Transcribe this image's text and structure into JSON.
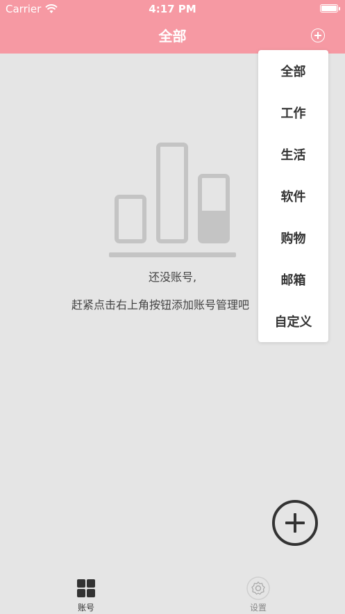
{
  "status_bar": {
    "carrier": "Carrier",
    "time": "4:17 PM",
    "wifi_icon": "wifi-icon",
    "battery_icon": "battery-icon"
  },
  "nav": {
    "title": "全部",
    "add_icon": "plus-circle-icon"
  },
  "empty_state": {
    "illustration_icon": "bar-chart-icon",
    "line1": "还没账号,",
    "line2": "赶紧点击右上角按钮添加账号管理吧"
  },
  "dropdown": {
    "items": [
      "全部",
      "工作",
      "生活",
      "软件",
      "购物",
      "邮箱",
      "自定义"
    ]
  },
  "fab": {
    "icon": "plus-circle-icon"
  },
  "tabbar": {
    "tabs": [
      {
        "label": "账号",
        "icon": "grid-icon",
        "active": true
      },
      {
        "label": "设置",
        "icon": "gear-icon",
        "active": false
      }
    ]
  },
  "colors": {
    "header": "#f699a3",
    "background": "#e5e5e5",
    "illustration": "#c4c4c4",
    "text_dark": "#333333"
  }
}
